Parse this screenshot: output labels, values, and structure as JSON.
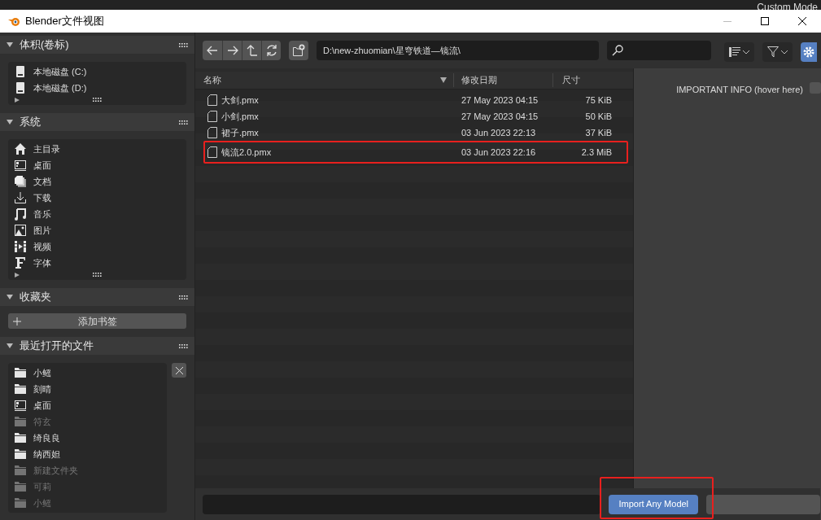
{
  "background_text": "Custom Mode",
  "window": {
    "title": "Blender文件视图"
  },
  "sidebar": [
    {
      "title": "体积(卷标)",
      "expanded": true,
      "items": [
        {
          "label": "本地磁盘 (C:)",
          "kind": "drive",
          "disabled": false
        },
        {
          "label": "本地磁盘 (D:)",
          "kind": "drive",
          "disabled": false
        }
      ]
    },
    {
      "title": "系统",
      "expanded": true,
      "items": [
        {
          "label": "主目录",
          "kind": "home",
          "disabled": false
        },
        {
          "label": "桌面",
          "kind": "desktop",
          "disabled": false
        },
        {
          "label": "文档",
          "kind": "documents",
          "disabled": false
        },
        {
          "label": "下载",
          "kind": "download",
          "disabled": false
        },
        {
          "label": "音乐",
          "kind": "music",
          "disabled": false
        },
        {
          "label": "图片",
          "kind": "image",
          "disabled": false
        },
        {
          "label": "视频",
          "kind": "video",
          "disabled": false
        },
        {
          "label": "字体",
          "kind": "font",
          "disabled": false
        }
      ]
    },
    {
      "title": "收藏夹",
      "expanded": true,
      "button": "添加书签"
    },
    {
      "title": "最近打开的文件",
      "expanded": true,
      "items": [
        {
          "label": "小鳐",
          "kind": "folder",
          "disabled": false
        },
        {
          "label": "刻晴",
          "kind": "folder",
          "disabled": false
        },
        {
          "label": "桌面",
          "kind": "desktop",
          "disabled": false
        },
        {
          "label": "符玄",
          "kind": "folder",
          "disabled": true
        },
        {
          "label": "绮良良",
          "kind": "folder",
          "disabled": false
        },
        {
          "label": "纳西妲",
          "kind": "folder",
          "disabled": false
        },
        {
          "label": "新建文件夹",
          "kind": "folder",
          "disabled": true
        },
        {
          "label": "可莉",
          "kind": "folder",
          "disabled": true
        },
        {
          "label": "小鳐",
          "kind": "folder",
          "disabled": true
        }
      ]
    }
  ],
  "toolbar": {
    "path": "D:\\new-zhuomian\\星穹铁道—镜流\\"
  },
  "table": {
    "columns": [
      "名称",
      "修改日期",
      "尺寸"
    ],
    "rows": [
      {
        "name": "大剑.pmx",
        "date": "27 May 2023 04:15",
        "size": "75 KiB",
        "highlighted": false
      },
      {
        "name": "小剑.pmx",
        "date": "27 May 2023 04:15",
        "size": "50 KiB",
        "highlighted": false
      },
      {
        "name": "裙子.pmx",
        "date": "03 Jun 2023 22:13",
        "size": "37 KiB",
        "highlighted": false
      },
      {
        "name": "镜流2.0.pmx",
        "date": "03 Jun 2023 22:16",
        "size": "2.3 MiB",
        "highlighted": true
      }
    ]
  },
  "side_panel": {
    "option": "IMPORTANT INFO (hover here)",
    "checked": false
  },
  "footer": {
    "import_button": "Import Any Model",
    "highlighted": true
  }
}
